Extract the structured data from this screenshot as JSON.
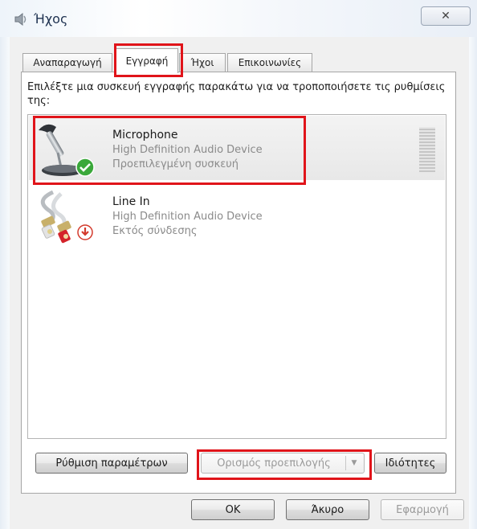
{
  "window": {
    "title": "Ήχος",
    "close_glyph": "✕"
  },
  "tabs": [
    {
      "label": "Αναπαραγωγή",
      "active": false
    },
    {
      "label": "Εγγραφή",
      "active": true
    },
    {
      "label": "Ήχοι",
      "active": false
    },
    {
      "label": "Επικοινωνίες",
      "active": false
    }
  ],
  "instruction": "Επιλέξτε μια συσκευή εγγραφής παρακάτω για να τροποποιήσετε τις ρυθμίσεις της:",
  "devices": [
    {
      "name": "Microphone",
      "description": "High Definition Audio Device",
      "status": "Προεπιλεγμένη συσκευή",
      "icon": "microphone-icon",
      "status_badge": "check-badge-icon",
      "selected": true
    },
    {
      "name": "Line In",
      "description": "High Definition Audio Device",
      "status": "Εκτός σύνδεσης",
      "icon": "line-in-cable-icon",
      "status_badge": "unplugged-badge-icon",
      "selected": false
    }
  ],
  "buttons": {
    "configure": "Ρύθμιση παραμέτρων",
    "set_default": "Ορισμός προεπιλογής",
    "properties": "Ιδιότητες",
    "ok": "OK",
    "cancel": "Άκυρο",
    "apply": "Εφαρμογή"
  },
  "colors": {
    "highlight": "#e0141a",
    "check": "#3aa83a",
    "unplugged": "#d33a2c"
  }
}
